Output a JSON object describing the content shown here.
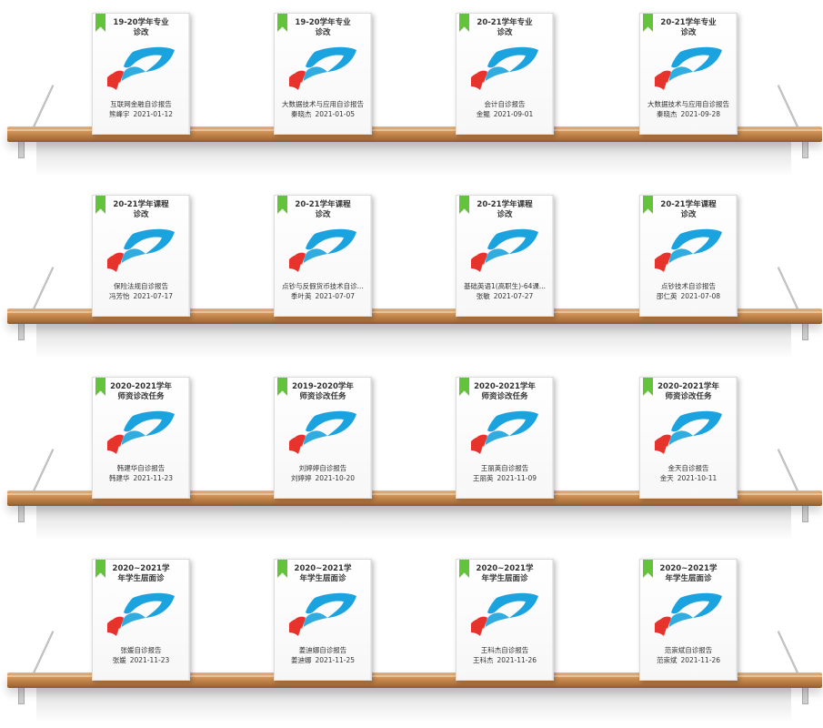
{
  "shelves": [
    {
      "books": [
        {
          "title1": "19-20学年专业",
          "title2": "诊改",
          "desc": "互联网金融自诊报告",
          "author": "熊峰宇",
          "date": "2021-01-12"
        },
        {
          "title1": "19-20学年专业",
          "title2": "诊改",
          "desc": "大数据技术与应用自诊报告",
          "author": "秦晓杰",
          "date": "2021-01-05"
        },
        {
          "title1": "20-21学年专业",
          "title2": "诊改",
          "desc": "会计自诊报告",
          "author": "金鲲",
          "date": "2021-09-01"
        },
        {
          "title1": "20-21学年专业",
          "title2": "诊改",
          "desc": "大数据技术与应用自诊报告",
          "author": "秦晓杰",
          "date": "2021-09-28"
        }
      ]
    },
    {
      "books": [
        {
          "title1": "20-21学年课程",
          "title2": "诊改",
          "desc": "保险法规自诊报告",
          "author": "冯芳怡",
          "date": "2021-07-17"
        },
        {
          "title1": "20-21学年课程",
          "title2": "诊改",
          "desc": "点钞与反假货币技术自诊...",
          "author": "季叶英",
          "date": "2021-07-07"
        },
        {
          "title1": "20-21学年课程",
          "title2": "诊改",
          "desc": "基础英语1(高职生)-64课...",
          "author": "张敏",
          "date": "2021-07-27"
        },
        {
          "title1": "20-21学年课程",
          "title2": "诊改",
          "desc": "点钞技术自诊报告",
          "author": "邵仁英",
          "date": "2021-07-08"
        }
      ]
    },
    {
      "books": [
        {
          "title1": "2020-2021学年",
          "title2": "师资诊改任务",
          "desc": "韩建华自诊报告",
          "author": "韩建华",
          "date": "2021-11-23"
        },
        {
          "title1": "2019-2020学年",
          "title2": "师资诊改任务",
          "desc": "刘婷婷自诊报告",
          "author": "刘婷婷",
          "date": "2021-10-20"
        },
        {
          "title1": "2020-2021学年",
          "title2": "师资诊改任务",
          "desc": "王丽英自诊报告",
          "author": "王丽英",
          "date": "2021-11-09"
        },
        {
          "title1": "2020-2021学年",
          "title2": "师资诊改任务",
          "desc": "金天自诊报告",
          "author": "金天",
          "date": "2021-10-11"
        }
      ]
    },
    {
      "books": [
        {
          "title1": "2020~2021学",
          "title2": "年学生层面诊",
          "desc": "张媛自诊报告",
          "author": "张媛",
          "date": "2021-11-23"
        },
        {
          "title1": "2020~2021学",
          "title2": "年学生层面诊",
          "desc": "姜迪娜自诊报告",
          "author": "姜迪娜",
          "date": "2021-11-25"
        },
        {
          "title1": "2020~2021学",
          "title2": "年学生层面诊",
          "desc": "王科杰自诊报告",
          "author": "王科杰",
          "date": "2021-11-26"
        },
        {
          "title1": "2020~2021学",
          "title2": "年学生层面诊",
          "desc": "范崇斌自诊报告",
          "author": "范崇斌",
          "date": "2021-11-26"
        }
      ]
    }
  ],
  "colors": {
    "bookmark": "#63c33a",
    "logo_blue": "#1aa3de",
    "logo_red": "#e8322c",
    "shelf": "#c88a4f"
  },
  "icons": {
    "logo": "brand-logo-icon",
    "bookmark": "bookmark-icon"
  }
}
